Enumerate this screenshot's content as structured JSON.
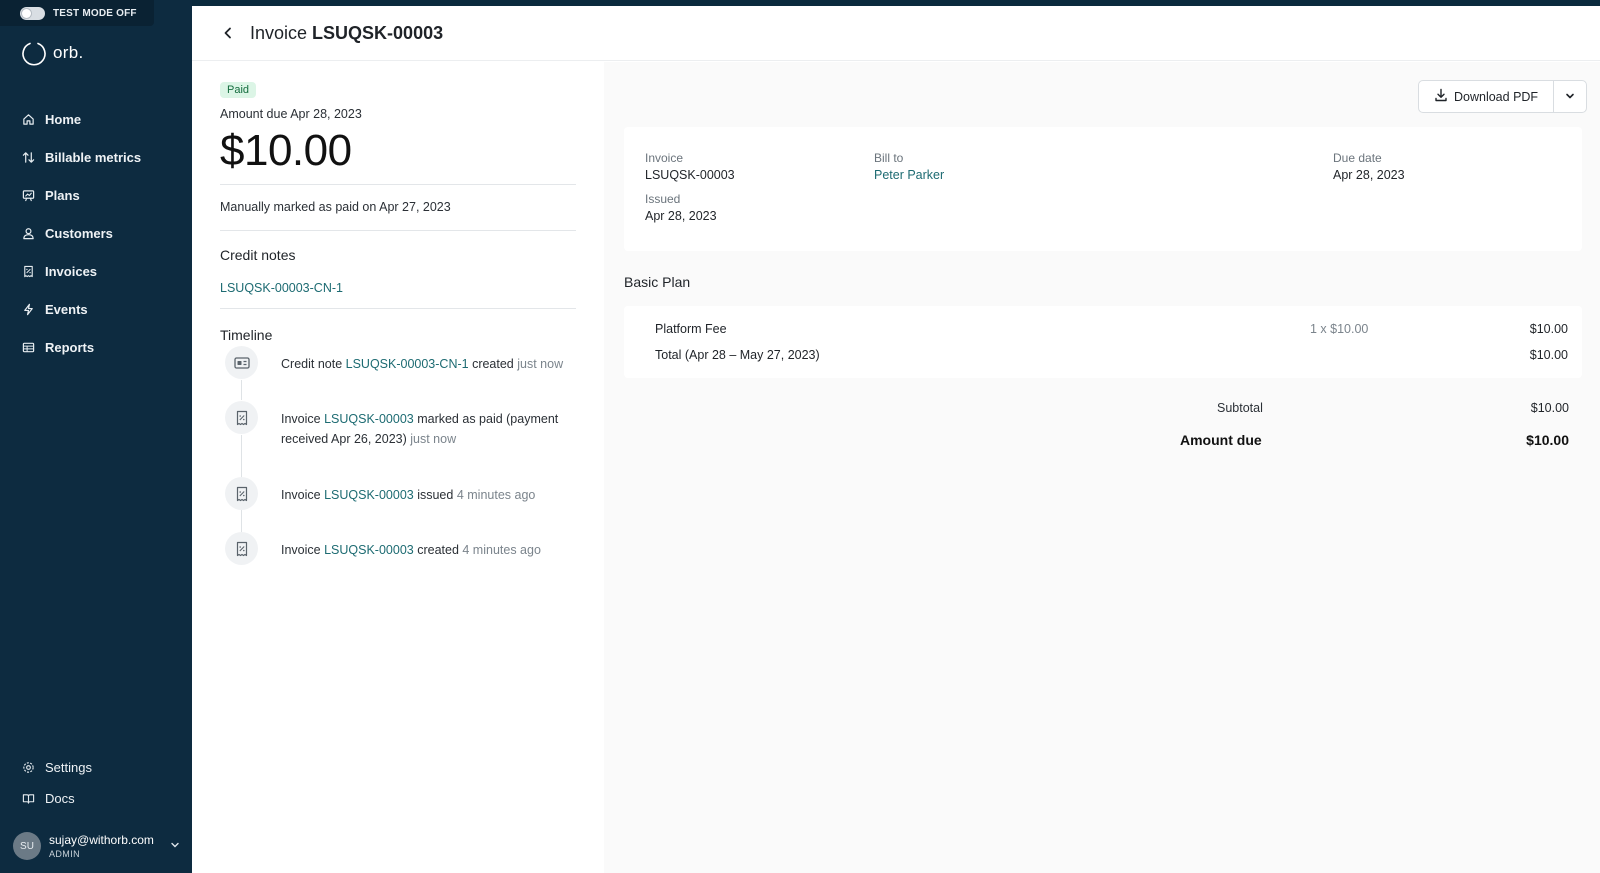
{
  "sidebar": {
    "test_mode_label": "TEST MODE OFF",
    "logo_text": "orb.",
    "nav": [
      {
        "label": "Home",
        "icon": "home-icon"
      },
      {
        "label": "Billable metrics",
        "icon": "arrows-updown-icon"
      },
      {
        "label": "Plans",
        "icon": "plans-icon"
      },
      {
        "label": "Customers",
        "icon": "users-icon"
      },
      {
        "label": "Invoices",
        "icon": "receipt-icon"
      },
      {
        "label": "Events",
        "icon": "bolt-icon"
      },
      {
        "label": "Reports",
        "icon": "table-icon"
      }
    ],
    "bottom_nav": [
      {
        "label": "Settings",
        "icon": "gear-icon"
      },
      {
        "label": "Docs",
        "icon": "book-icon"
      }
    ],
    "user": {
      "initials": "SU",
      "email": "sujay@withorb.com",
      "role": "ADMIN"
    }
  },
  "header": {
    "prefix": "Invoice",
    "invoice_id": "LSUQSK-00003"
  },
  "summary": {
    "status_badge": "Paid",
    "amount_due_label": "Amount due Apr 28, 2023",
    "amount": "$10.00",
    "paid_note": "Manually marked as paid on Apr 27, 2023",
    "credit_notes_heading": "Credit notes",
    "credit_note_link": "LSUQSK-00003-CN-1",
    "timeline_heading": "Timeline"
  },
  "timeline": [
    {
      "pre": "Credit note ",
      "link": "LSUQSK-00003-CN-1",
      "post": " created ",
      "when": "just now",
      "icon": "credit-note-icon"
    },
    {
      "pre": "Invoice ",
      "link": "LSUQSK-00003",
      "post": " marked as paid (payment received Apr 26, 2023) ",
      "when": "just now",
      "icon": "receipt-icon"
    },
    {
      "pre": "Invoice ",
      "link": "LSUQSK-00003",
      "post": " issued ",
      "when": "4 minutes ago",
      "icon": "receipt-icon"
    },
    {
      "pre": "Invoice ",
      "link": "LSUQSK-00003",
      "post": " created ",
      "when": "4 minutes ago",
      "icon": "receipt-icon"
    }
  ],
  "actions": {
    "download_label": "Download PDF"
  },
  "invoice_meta": {
    "invoice_label": "Invoice",
    "invoice_value": "LSUQSK-00003",
    "issued_label": "Issued",
    "issued_value": "Apr 28, 2023",
    "bill_to_label": "Bill to",
    "bill_to_value": "Peter Parker",
    "due_date_label": "Due date",
    "due_date_value": "Apr 28, 2023"
  },
  "plan": {
    "name": "Basic Plan",
    "line_item": {
      "name": "Platform Fee",
      "qty_price": "1 x $10.00",
      "amount": "$10.00"
    },
    "total_label": "Total (Apr 28 – May 27, 2023)",
    "total_amount": "$10.00"
  },
  "totals": {
    "subtotal_label": "Subtotal",
    "subtotal_value": "$10.00",
    "amount_due_label": "Amount due",
    "amount_due_value": "$10.00"
  },
  "colors": {
    "sidebar_bg": "#0d2b40",
    "link": "#1d6b72",
    "paid_badge_bg": "#dcf5e6"
  }
}
